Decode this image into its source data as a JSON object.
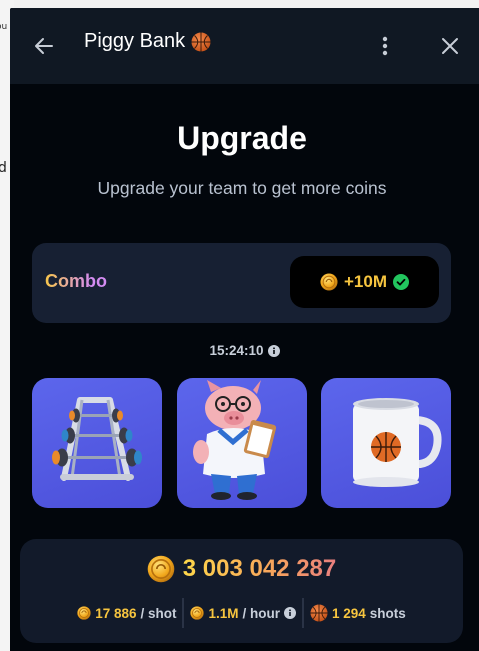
{
  "background": {
    "peek_text_1": "ou",
    "peek_text_2": "d"
  },
  "titlebar": {
    "title": "Piggy Bank"
  },
  "upgrade": {
    "heading": "Upgrade",
    "subtitle": "Upgrade your team to get more coins"
  },
  "combo": {
    "label": "Combo",
    "reward": "+10M"
  },
  "timer": {
    "value": "15:24:10"
  },
  "cards": [
    {
      "item": "dumbbell rack"
    },
    {
      "item": "pig coach with clipboard"
    },
    {
      "item": "basketball mug"
    }
  ],
  "stats": {
    "balance": "3 003 042 287",
    "per_shot_value": "17 886",
    "per_shot_unit": "/ shot",
    "per_hour_value": "1.1M",
    "per_hour_unit": "/ hour",
    "shots_value": "1 294",
    "shots_unit": "shots"
  },
  "colors": {
    "window_bg": "#02060c",
    "titlebar_bg": "#101823",
    "card_bg": "#172033",
    "accent_gold": "#f7c53f",
    "card_purple": "#5c66ec",
    "check_green": "#22c55e"
  },
  "icons": [
    "arrow-left-icon",
    "basketball-icon",
    "more-vertical-icon",
    "close-icon",
    "coin-icon",
    "check-circle-icon",
    "info-icon"
  ]
}
